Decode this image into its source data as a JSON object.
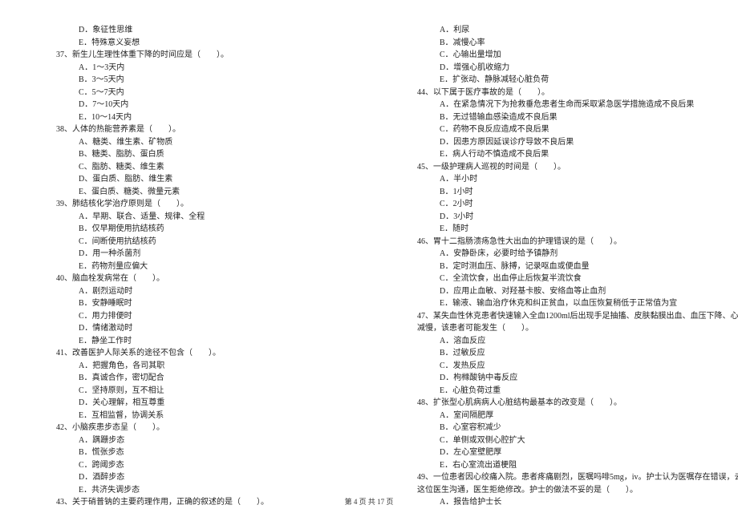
{
  "left_column": [
    {
      "cls": "indent-option",
      "text": "D．象征性思维"
    },
    {
      "cls": "indent-option",
      "text": "E．特殊意义妄想"
    },
    {
      "cls": "indent-question",
      "text": "37、新生儿生理性体重下降的时间应是（　　）。"
    },
    {
      "cls": "indent-option",
      "text": "A．1～3天内"
    },
    {
      "cls": "indent-option",
      "text": "B．3～5天内"
    },
    {
      "cls": "indent-option",
      "text": "C．5～7天内"
    },
    {
      "cls": "indent-option",
      "text": "D．7～10天内"
    },
    {
      "cls": "indent-option",
      "text": "E．10～14天内"
    },
    {
      "cls": "indent-question",
      "text": "38、人体的热能营养素是（　　）。"
    },
    {
      "cls": "indent-option",
      "text": "A、糖类、维生素、矿物质"
    },
    {
      "cls": "indent-option",
      "text": "B、糖类、脂肪、蛋白质"
    },
    {
      "cls": "indent-option",
      "text": "C、脂肪、糖类、维生素"
    },
    {
      "cls": "indent-option",
      "text": "D、蛋白质、脂肪、维生素"
    },
    {
      "cls": "indent-option",
      "text": "E、蛋白质、糖类、微量元素"
    },
    {
      "cls": "indent-question",
      "text": "39、肺结核化学治疗原则是（　　）。"
    },
    {
      "cls": "indent-option",
      "text": "A．早期、联合、适量、规律、全程"
    },
    {
      "cls": "indent-option",
      "text": "B．仅早期使用抗结核药"
    },
    {
      "cls": "indent-option",
      "text": "C．间断使用抗结核药"
    },
    {
      "cls": "indent-option",
      "text": "D．用一种杀菌剂"
    },
    {
      "cls": "indent-option",
      "text": "E．药物剂量应偏大"
    },
    {
      "cls": "indent-question",
      "text": "40、脑血栓发病常在（　　）。"
    },
    {
      "cls": "indent-option",
      "text": "A．剧烈运动时"
    },
    {
      "cls": "indent-option",
      "text": "B．安静睡眠时"
    },
    {
      "cls": "indent-option",
      "text": "C．用力排便时"
    },
    {
      "cls": "indent-option",
      "text": "D．情绪激动时"
    },
    {
      "cls": "indent-option",
      "text": "E．静坐工作时"
    },
    {
      "cls": "indent-question",
      "text": "41、改善医护人际关系的途径不包含（　　）。"
    },
    {
      "cls": "indent-option",
      "text": "A．把握角色，各司其职"
    },
    {
      "cls": "indent-option",
      "text": "B．真诚合作，密切配合"
    },
    {
      "cls": "indent-option",
      "text": "C．坚持原则，互不相让"
    },
    {
      "cls": "indent-option",
      "text": "D．关心理解，相互尊重"
    },
    {
      "cls": "indent-option",
      "text": "E．互相监督，协调关系"
    },
    {
      "cls": "indent-question",
      "text": "42、小脑疾患步态呈（　　）。"
    },
    {
      "cls": "indent-option",
      "text": "A．蹒跚步态"
    },
    {
      "cls": "indent-option",
      "text": "B．慌张步态"
    },
    {
      "cls": "indent-option",
      "text": "C．跨阈步态"
    },
    {
      "cls": "indent-option",
      "text": "D．酒醉步态"
    },
    {
      "cls": "indent-option",
      "text": "E．共济失调步态"
    },
    {
      "cls": "indent-question",
      "text": "43、关于硝普钠的主要药理作用，正确的叙述的是（　　）。"
    }
  ],
  "right_column": [
    {
      "cls": "indent-option",
      "text": "A．利尿"
    },
    {
      "cls": "indent-option",
      "text": "B．减慢心率"
    },
    {
      "cls": "indent-option",
      "text": "C．心输出量增加"
    },
    {
      "cls": "indent-option",
      "text": "D．增强心肌收缩力"
    },
    {
      "cls": "indent-option",
      "text": "E．扩张动、静脉减轻心脏负荷"
    },
    {
      "cls": "indent-question",
      "text": "44、以下属于医疗事故的是（　　）。"
    },
    {
      "cls": "indent-option",
      "text": "A．在紧急情况下为抢救垂危患者生命而采取紧急医学措施造成不良后果"
    },
    {
      "cls": "indent-option",
      "text": "B．无过错输血感染造成不良后果"
    },
    {
      "cls": "indent-option",
      "text": "C．药物不良反应造成不良后果"
    },
    {
      "cls": "indent-option",
      "text": "D．因患方原因延误诊疗导致不良后果"
    },
    {
      "cls": "indent-option",
      "text": "E．病人行动不慎造成不良后果"
    },
    {
      "cls": "indent-question",
      "text": "45、一级护理病人巡视的时间是（　　）。"
    },
    {
      "cls": "indent-option",
      "text": "A．半小时"
    },
    {
      "cls": "indent-option",
      "text": "B．1小时"
    },
    {
      "cls": "indent-option",
      "text": "C．2小时"
    },
    {
      "cls": "indent-option",
      "text": "D．3小时"
    },
    {
      "cls": "indent-option",
      "text": "E．随时"
    },
    {
      "cls": "indent-question",
      "text": "46、胃十二指肠溃疡急性大出血的护理错误的是（　　）。"
    },
    {
      "cls": "indent-option",
      "text": "A．安静卧床，必要时给予镇静剂"
    },
    {
      "cls": "indent-option",
      "text": "B．定时测血压、脉搏，记录呕血或便血量"
    },
    {
      "cls": "indent-option",
      "text": "C．全流饮食，出血停止后恢复半流饮食"
    },
    {
      "cls": "indent-option",
      "text": "D．应用止血敏、对羟基卡胺、安络血等止血剂"
    },
    {
      "cls": "indent-option",
      "text": "E．输液、输血治疗休克和纠正贫血，以血压恢复稍低于正常值为宜"
    },
    {
      "cls": "indent-question",
      "text": "47、某失血性休克患者快速输入全血1200ml后出现手足抽搐、皮肤黏膜出血、血压下降、心率"
    },
    {
      "cls": "indent-question",
      "text": "减慢，该患者可能发生（　　）。"
    },
    {
      "cls": "indent-option",
      "text": "A．溶血反应"
    },
    {
      "cls": "indent-option",
      "text": "B．过敏反应"
    },
    {
      "cls": "indent-option",
      "text": "C．发热反应"
    },
    {
      "cls": "indent-option",
      "text": "D．枸橼酸钠中毒反应"
    },
    {
      "cls": "indent-option",
      "text": "E．心脏负荷过重"
    },
    {
      "cls": "indent-question",
      "text": "48、扩张型心肌病病人心脏结构最基本的改变是（　　）。"
    },
    {
      "cls": "indent-option",
      "text": "A．室间隔肥厚"
    },
    {
      "cls": "indent-option",
      "text": "B．心室容积减少"
    },
    {
      "cls": "indent-option",
      "text": "C．单侧或双侧心腔扩大"
    },
    {
      "cls": "indent-option",
      "text": "D．左心室壁肥厚"
    },
    {
      "cls": "indent-option",
      "text": "E．右心室流出道梗阻"
    },
    {
      "cls": "indent-question",
      "text": "49、一位患者因心绞痛入院。患者疼痛剧烈，医嘱吗啡5mg，iv。护士认为医嘱存在错误，去找"
    },
    {
      "cls": "indent-question",
      "text": "这位医生沟通，医生拒绝修改。护士的做法不妥的是（　　）。"
    },
    {
      "cls": "indent-option",
      "text": "A．报告给护士长"
    }
  ],
  "footer": "第 4 页 共 17 页"
}
